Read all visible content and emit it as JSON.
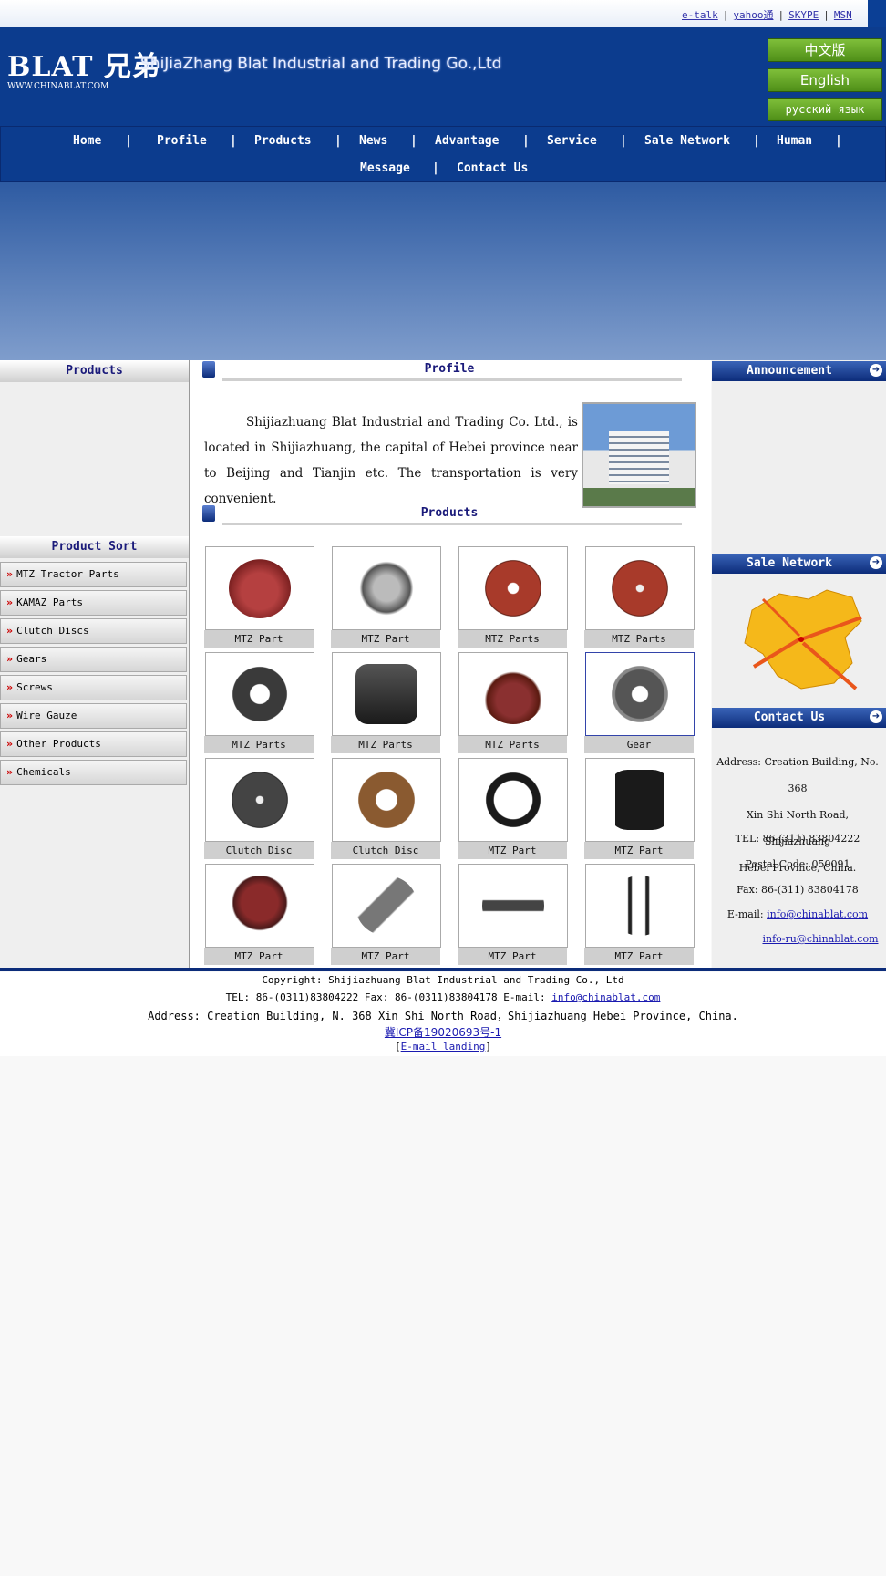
{
  "top_links": [
    "e-talk",
    "yahoo通",
    "SKYPE",
    "MSN"
  ],
  "logo": {
    "main": "BLAT 兄弟",
    "sub": "WWW.CHINABLAT.COM"
  },
  "company_name": "ShiJiaZhang Blat Industrial  and Trading Go.,Ltd",
  "languages": [
    "中文版",
    "English",
    "русский язык"
  ],
  "nav": [
    "Home",
    "Profile",
    "Products",
    "News",
    "Advantage",
    "Service",
    "Sale Network",
    "Human",
    "Message",
    "Contact Us"
  ],
  "left": {
    "products_title": "Products",
    "sort_title": "Product Sort",
    "sort_items": [
      "MTZ Tractor Parts",
      "KAMAZ Parts",
      "Clutch Discs",
      "Gears",
      "Screws",
      "Wire Gauze",
      "Other Products",
      "Chemicals"
    ]
  },
  "center": {
    "profile_title": "Profile",
    "profile_text": "Shijiazhuang Blat Industrial and Trading Co. Ltd., is located in Shijiazhuang, the capital of Hebei province near to Beijing and Tianjin etc. The transportation is very convenient.",
    "products_title": "Products",
    "products": [
      "MTZ Part",
      "MTZ Part",
      "MTZ Parts",
      "MTZ Parts",
      "MTZ Parts",
      "MTZ Parts",
      "MTZ Parts",
      "Gear",
      "Clutch Disc",
      "Clutch Disc",
      "MTZ Part",
      "MTZ Part",
      "MTZ Part",
      "MTZ Part",
      "MTZ Part",
      "MTZ Part"
    ]
  },
  "right": {
    "announcement_title": "Announcement",
    "sale_network_title": "Sale Network",
    "contact_title": "Contact Us",
    "address_lines": [
      "Address: Creation Building, No. 368",
      "Xin Shi North Road, Shijiazhuang",
      "Hebei Province, China."
    ],
    "tel": "TEL: 86-(311) 83804222",
    "postal": "Postal Code: 050091",
    "fax": "Fax: 86-(311) 83804178",
    "email_label": "E-mail: ",
    "email1": "info@chinablat.com",
    "email2": "info-ru@chinablat.com"
  },
  "footer": {
    "copyright": "Copyright: Shijiazhuang Blat Industrial and Trading Co., Ltd",
    "tel_fax": "TEL: 86-(0311)83804222    Fax: 86-(0311)83804178    E-mail: ",
    "email": "info@chinablat.com",
    "address": "Address:  Creation Building, N. 368 Xin Shi North Road，Shijiazhuang Hebei Province, China.",
    "icp": "冀ICP备19020693号-1",
    "landing": "E-mail landing"
  },
  "colors": {
    "header_blue": "#0c3c8e",
    "accent_green": "#6aaa2a",
    "link": "#1a1ab0"
  }
}
